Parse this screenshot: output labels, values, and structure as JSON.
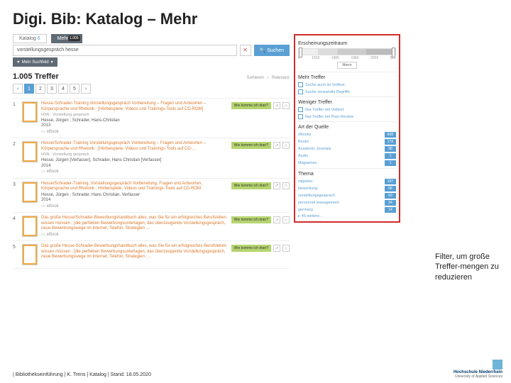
{
  "title": "Digi. Bib: Katalog – Mehr",
  "tabs": {
    "katalog": "Katalog",
    "mehr": "Mehr",
    "badge": "1.005"
  },
  "search": {
    "value": "vorstellungsgespräch hesse",
    "button": "Suchen"
  },
  "subbar": "Mein Suchfeld",
  "hits": "1.005 Treffer",
  "sort": {
    "label": "Sortieren",
    "value": "Relevanz"
  },
  "pages": [
    "‹",
    "1",
    "2",
    "3",
    "4",
    "5",
    "›"
  ],
  "results": [
    {
      "n": "1",
      "title": "Hesse-Schrader-Training Vorstellungsgespräch Vorbereitung – Fragen und Antworten – Körpersprache und Rhetorik ; [Hörbeispiele, Videos und Trainings-Tools auf CD-ROM]",
      "sub": "HSN : Vorstellung gesprach",
      "auth": "Hesse, Jürgen ; Schrader, Hans-Christian",
      "year": "2013",
      "type": "eBook"
    },
    {
      "n": "2",
      "title": "Hesse/Schrader-Training Vorstellungsgespräch Vorbereitung – Fragen und Antworten – Körpersprache und Rhetorik ; [Hörbeispiele, Videos und Trainings-Tools auf CD-…",
      "sub": "HSN : Vorstellung gesprach",
      "auth": "Hesse, Jürgen [Verfasser], Schrader, Hans Christian [Verfasser]",
      "year": "2014",
      "type": "eBook"
    },
    {
      "n": "3",
      "title": "Hesse/Schrader-Training, Vorstellungsgespräch Vorbereitung, Fragen und Antworten, Körpersprache und Rhetorik ; Hörbeispiele, Videos und Trainings-Tools auf CD-ROM",
      "sub": "",
      "auth": "Hesse, Jürgen ; Schrader, Hans Christian, Verfasser",
      "year": "2014",
      "type": "eBook"
    },
    {
      "n": "4",
      "title": "Das große Hesse/Schrader-Bewerbungshandbuch alles, was Sie für ein erfolgreiches Berufsleben wissen müssen ; [die perfekten Bewerbungsunterlagen, das überzeugende Vorstellungsgespräch, neue Bewerbungswege im Internet, Telefon, Strategien …",
      "sub": "",
      "auth": "",
      "year": "",
      "type": "eBook"
    },
    {
      "n": "5",
      "title": "Das große Hesse-Schrader-Bewerbungshandbuch alles, was Sie für ein erfolgreiches Berufsleben wissen müssen ; [die perfekten Bewerbungsunterlagen, das überzeugende Vorstellungsgespräch, neue Bewerbungswege im Internet, Telefon, Strategien …",
      "sub": "",
      "auth": "",
      "year": "",
      "type": ""
    }
  ],
  "avail": "Wie komme ich dran?",
  "filters": {
    "zeit": "Erscheinungszeitraum",
    "tl_labels": [
      "0",
      "1502",
      "1900",
      "filtern",
      "1960",
      "2002",
      "501"
    ],
    "tl_button": "filtern",
    "mehr_t": "Mehr Treffer",
    "mehr": [
      "Suche auch im Volltext",
      "Suche verwandte Begriffe"
    ],
    "weniger_t": "Weniger Treffer",
    "weniger": [
      "Nur Treffer mit Volltext",
      "Nur Treffer mit Peer-Review"
    ],
    "quelle_t": "Art der Quelle",
    "quelle": [
      {
        "label": "eBooks",
        "n": "608"
      },
      {
        "label": "Books",
        "n": "179"
      },
      {
        "label": "Academic Journals",
        "n": "98"
      },
      {
        "label": "Audio",
        "n": "1"
      },
      {
        "label": "Magazines",
        "n": "1"
      }
    ],
    "thema_t": "Thema",
    "thema": [
      {
        "label": "ratgeber",
        "n": "197"
      },
      {
        "label": "bewerbung",
        "n": "66"
      },
      {
        "label": "vorstellungsgesprach",
        "n": "63"
      },
      {
        "label": "personnel management",
        "n": "24"
      },
      {
        "label": "germany",
        "n": "14"
      }
    ],
    "more": "45 weitere…"
  },
  "annotation": "Filter, um große Treffer-mengen zu reduzieren",
  "footer": "| Bibliothekseinführung | K. Trens | Katalog | Stand: 18.05.2020",
  "logo": {
    "l1": "Hochschule Niederrhein",
    "l2": "University of Applied Sciences"
  }
}
